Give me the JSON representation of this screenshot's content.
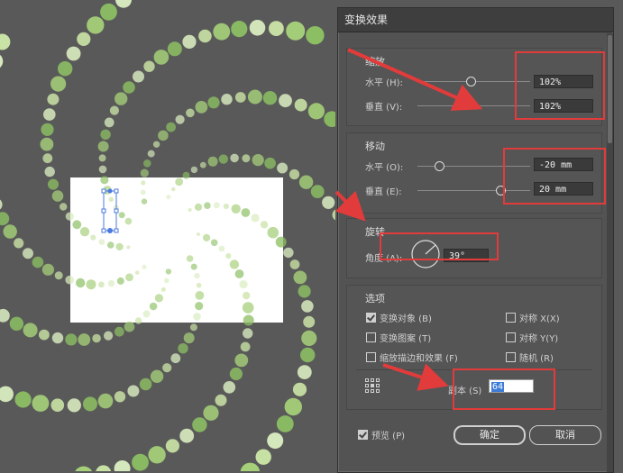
{
  "dialog": {
    "title": "变换效果",
    "scale": {
      "title": "缩放",
      "horizontal_label": "水平 (H):",
      "horizontal_value": "102%",
      "vertical_label": "垂直 (V):",
      "vertical_value": "102%"
    },
    "move": {
      "title": "移动",
      "horizontal_label": "水平 (O):",
      "horizontal_value": "-20 mm",
      "vertical_label": "垂直 (E):",
      "vertical_value": "20 mm"
    },
    "rotate": {
      "title": "旋转",
      "angle_label": "角度 (A):",
      "angle_value": "39°"
    },
    "options": {
      "title": "选项",
      "transform_objects": "变换对象 (B)",
      "transform_patterns": "变换图案 (T)",
      "scale_strokes": "缩放描边和效果 (F)",
      "reflect_x": "对称 X(X)",
      "reflect_y": "对称 Y(Y)",
      "random": "随机 (R)",
      "copies_label": "副本 (S)",
      "copies_value": "64"
    },
    "preview_label": "预览 (P)",
    "ok_label": "确定",
    "cancel_label": "取消"
  },
  "colors": {
    "canvas": "#595959",
    "dialog": "#535353",
    "highlight": "#e23b3b",
    "dot_light": "#c9e2a5",
    "dot_mid": "#a5cf79",
    "dot_dark": "#8cbf63",
    "selection": "#4a7ae0"
  }
}
